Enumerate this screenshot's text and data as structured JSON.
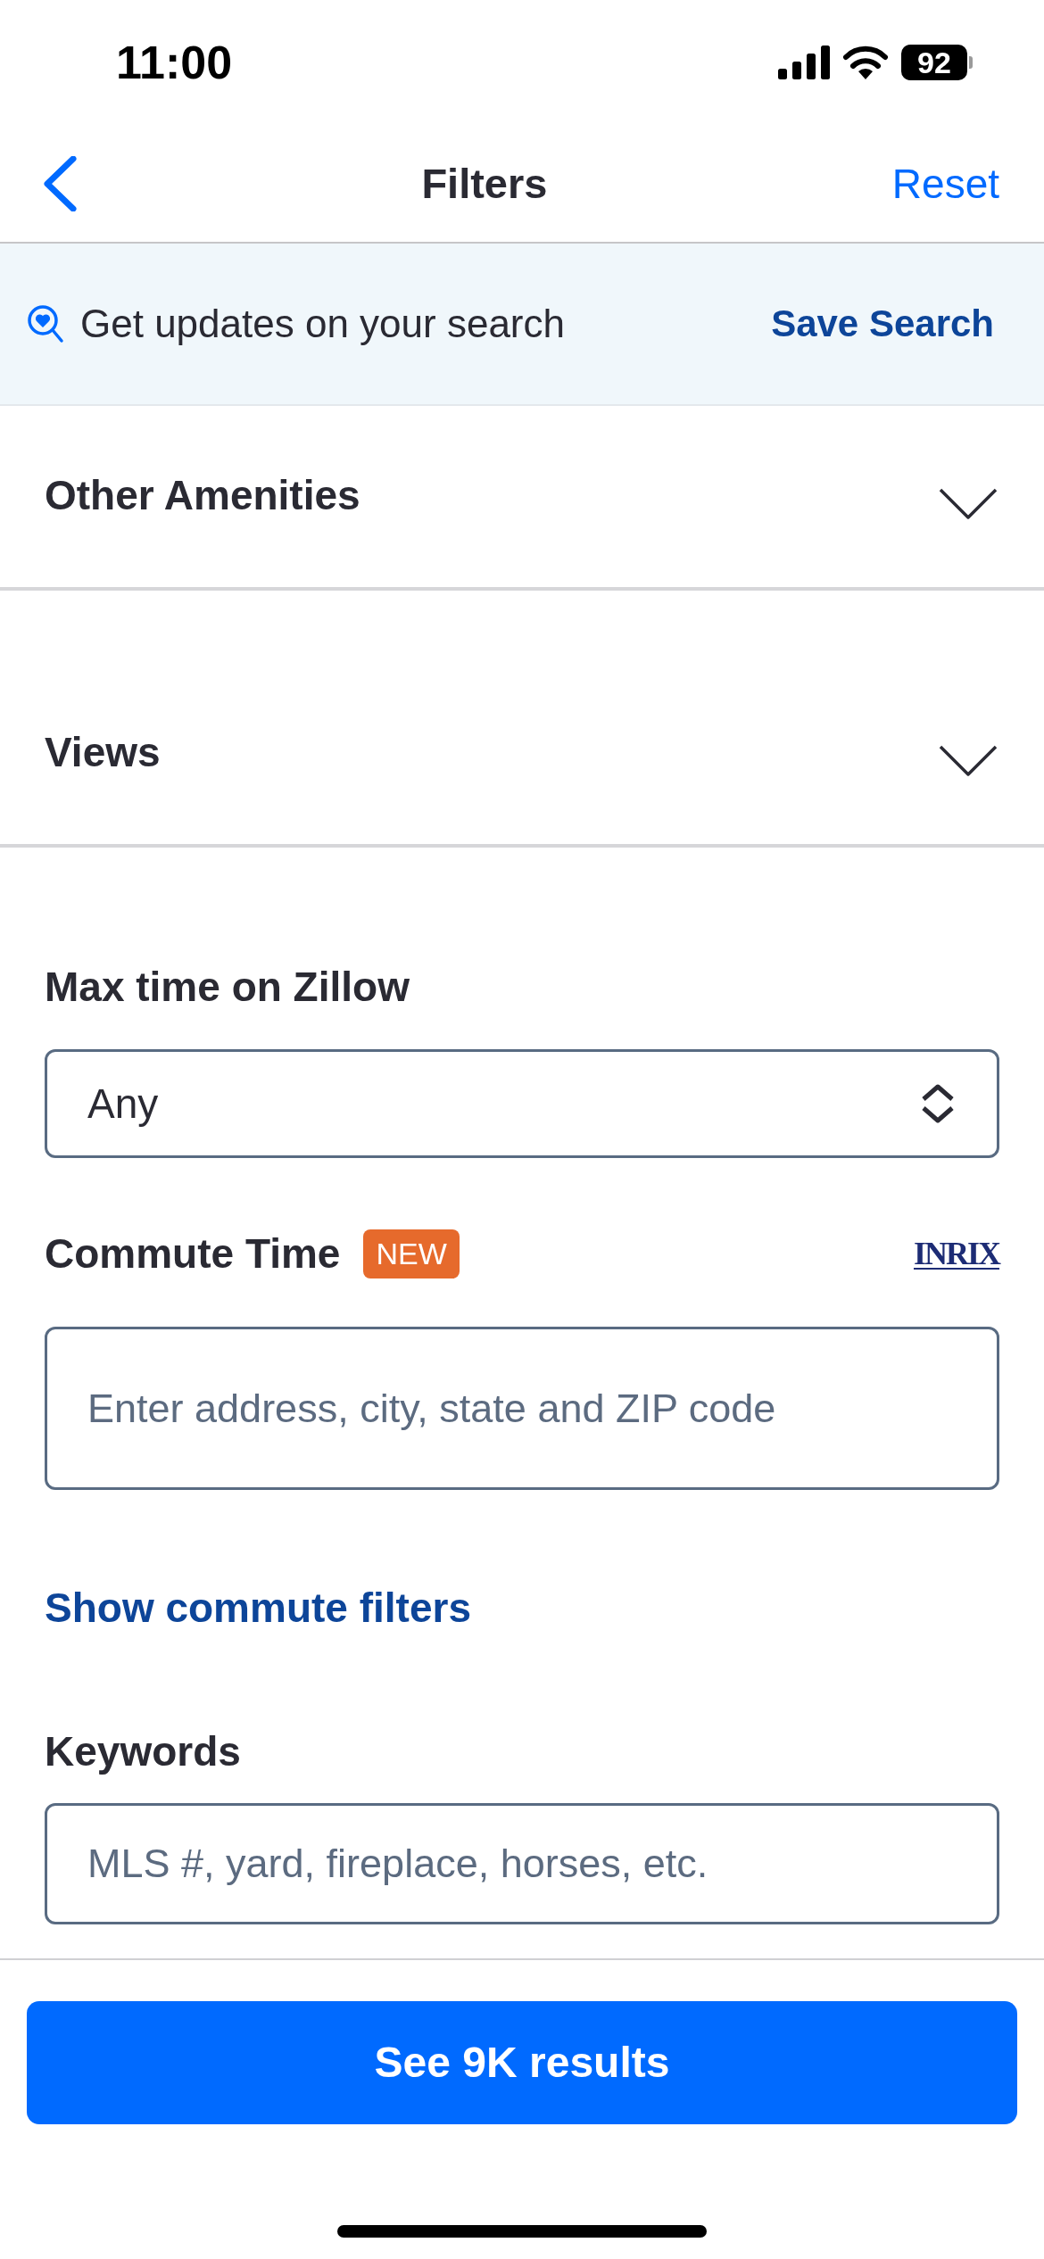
{
  "status_bar": {
    "time": "11:00",
    "battery": "92"
  },
  "header": {
    "title": "Filters",
    "action": "Reset"
  },
  "banner": {
    "text": "Get updates on your search",
    "action": "Save Search"
  },
  "sections": [
    {
      "title": "Other Amenities",
      "expanded": false
    },
    {
      "title": "Views",
      "expanded": false
    }
  ],
  "max_time": {
    "label": "Max time on Zillow",
    "value": "Any"
  },
  "commute": {
    "label": "Commute Time",
    "badge": "NEW",
    "logo": "INRIX",
    "placeholder": "Enter address, city, state and ZIP code",
    "link": "Show commute filters"
  },
  "keywords": {
    "label": "Keywords",
    "placeholder": "MLS #, yard, fireplace, horses, etc."
  },
  "footer": {
    "button": "See 9K results"
  }
}
